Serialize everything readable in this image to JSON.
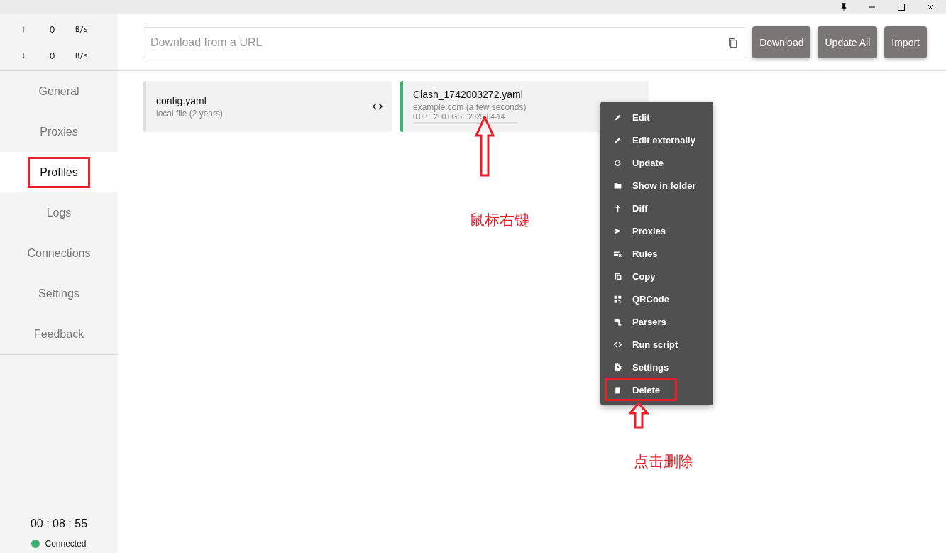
{
  "traffic": [
    {
      "arrow": "↑",
      "value": "0",
      "unit": "B/s"
    },
    {
      "arrow": "↓",
      "value": "0",
      "unit": "B/s"
    }
  ],
  "nav": [
    {
      "label": "General",
      "selected": false,
      "highlighted": false
    },
    {
      "label": "Proxies",
      "selected": false,
      "highlighted": false
    },
    {
      "label": "Profiles",
      "selected": true,
      "highlighted": true
    },
    {
      "label": "Logs",
      "selected": false,
      "highlighted": false
    },
    {
      "label": "Connections",
      "selected": false,
      "highlighted": false
    },
    {
      "label": "Settings",
      "selected": false,
      "highlighted": false
    },
    {
      "label": "Feedback",
      "selected": false,
      "highlighted": false
    }
  ],
  "uptime": "00 : 08 : 55",
  "status": {
    "label": "Connected",
    "color": "#3cb371"
  },
  "url_field": {
    "placeholder": "Download from a URL"
  },
  "buttons": [
    "Download",
    "Update All",
    "Import"
  ],
  "profiles": [
    {
      "kind": "local",
      "name": "config.yaml",
      "subtitle": "local file (2 years)",
      "selected": false
    },
    {
      "kind": "remote",
      "name": "Clash_1742003272.yaml",
      "subtitle": "example.com (a few seconds)",
      "used": "0.0B",
      "total": "200.0GB",
      "expires": "2025-04-14",
      "level": 0,
      "selected": true
    }
  ],
  "context_menu": [
    {
      "label": "Edit",
      "highlighted": false
    },
    {
      "label": "Edit externally",
      "highlighted": false
    },
    {
      "label": "Update",
      "highlighted": false
    },
    {
      "label": "Show in folder",
      "highlighted": false
    },
    {
      "label": "Diff",
      "highlighted": false
    },
    {
      "label": "Proxies",
      "highlighted": false
    },
    {
      "label": "Rules",
      "highlighted": false
    },
    {
      "label": "Copy",
      "highlighted": false
    },
    {
      "label": "QRCode",
      "highlighted": false
    },
    {
      "label": "Parsers",
      "highlighted": false
    },
    {
      "label": "Run script",
      "highlighted": false
    },
    {
      "label": "Settings",
      "highlighted": false
    },
    {
      "label": "Delete",
      "highlighted": true
    }
  ],
  "annotations": [
    "鼠标右键",
    "点击删除"
  ]
}
